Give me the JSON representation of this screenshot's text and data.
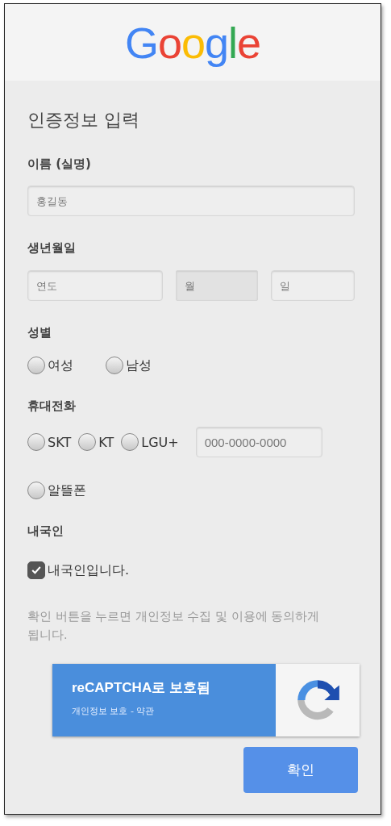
{
  "logo": "Google",
  "heading": "인증정보 입력",
  "name_section": {
    "label": "이름 (실명)",
    "field": {
      "placeholder": "홍길동"
    }
  },
  "birth_section": {
    "label": "생년월일",
    "fields": [
      {
        "kind": "input",
        "placeholder": "연도"
      },
      {
        "kind": "select",
        "placeholder": "월"
      },
      {
        "kind": "input",
        "placeholder": "일"
      }
    ]
  },
  "gender_section": {
    "label": "성별",
    "options": [
      {
        "label": "여성",
        "selected": false
      },
      {
        "label": "남성",
        "selected": false
      }
    ]
  },
  "phone_section": {
    "label": "휴대전화",
    "carriers": [
      {
        "label": "SKT",
        "selected": false
      },
      {
        "label": "KT",
        "selected": false
      },
      {
        "label": "LGU+",
        "selected": false
      },
      {
        "label": "알뜰폰",
        "selected": false
      }
    ],
    "field": {
      "placeholder": "000-0000-0000"
    }
  },
  "nationality_section": {
    "label": "내국인",
    "checkbox": {
      "label": "내국인입니다.",
      "checked": true
    }
  },
  "notice": "확인 버튼을 누르면 개인정보 수집 및 이용에 동의하게 됩니다.",
  "recaptcha": {
    "title": "reCAPTCHA로 보호됨",
    "links": "개인정보 보호 - 약관"
  },
  "submit": "확인"
}
